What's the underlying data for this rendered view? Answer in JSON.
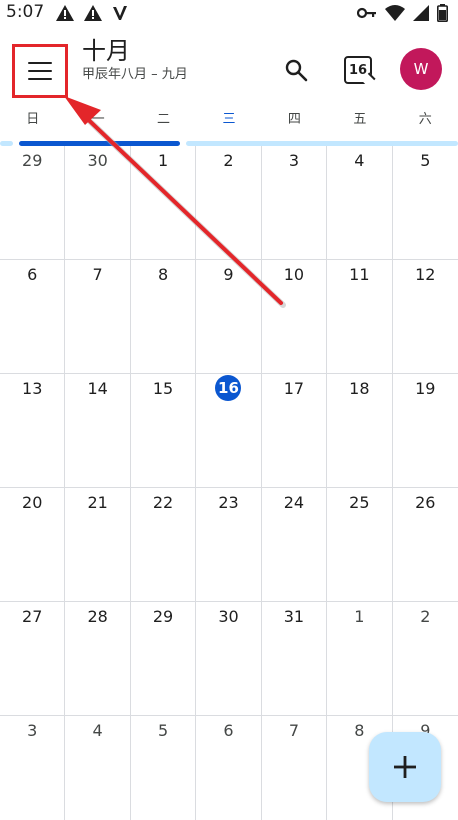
{
  "status_bar": {
    "time": "5:07",
    "left_icons": [
      "warning-icon",
      "warning-icon",
      "signal-v-icon"
    ],
    "right_icons": [
      "key-icon",
      "wifi-icon",
      "signal-icon",
      "battery-icon"
    ]
  },
  "header": {
    "month_title": "十月",
    "lunar_range": "甲辰年八月 – 九月",
    "today_number": "16",
    "avatar_initial": "W"
  },
  "weekdays": [
    "日",
    "一",
    "二",
    "三",
    "四",
    "五",
    "六"
  ],
  "today_weekday_index": 3,
  "weeks": [
    [
      "29",
      "30",
      "1",
      "2",
      "3",
      "4",
      "5"
    ],
    [
      "6",
      "7",
      "8",
      "9",
      "10",
      "11",
      "12"
    ],
    [
      "13",
      "14",
      "15",
      "16",
      "17",
      "18",
      "19"
    ],
    [
      "20",
      "21",
      "22",
      "23",
      "24",
      "25",
      "26"
    ],
    [
      "27",
      "28",
      "29",
      "30",
      "31",
      "1",
      "2"
    ],
    [
      "3",
      "4",
      "5",
      "6",
      "7",
      "8",
      "9"
    ]
  ],
  "colors": {
    "accent": "#0b57d0",
    "avatar": "#c2185b",
    "fab": "#c2e7ff",
    "annotation": "#e3262a"
  }
}
